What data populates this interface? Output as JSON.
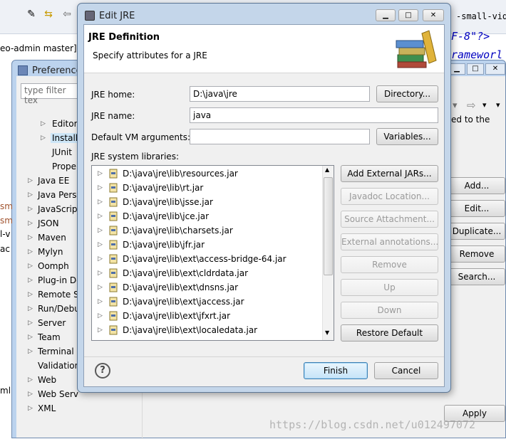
{
  "background": {
    "tab_fragment": "eo-admin master]",
    "code_lines": [
      "-small-video-",
      "F-8\"?>",
      "rameworl"
    ],
    "editor_text": "ed to the",
    "watermark": "https://blog.csdn.net/u012497072"
  },
  "preferences": {
    "title": "Preferences",
    "filter_placeholder": "type filter tex",
    "tree": [
      "Editor",
      "Installe",
      "JUnit",
      "Prope",
      "Java EE",
      "Java Pers",
      "JavaScript",
      "JSON",
      "Maven",
      "Mylyn",
      "Oomph",
      "Plug-in De",
      "Remote S",
      "Run/Debu",
      "Server",
      "Team",
      "Terminal",
      "Validation",
      "Web",
      "Web Serv",
      "XML"
    ],
    "buttons": {
      "add": "Add...",
      "edit": "Edit...",
      "duplicate": "Duplicate...",
      "remove": "Remove",
      "search": "Search...",
      "apply": "Apply"
    },
    "left_fragments": [
      "sm",
      "sm",
      "l-v",
      "ac",
      "ml"
    ]
  },
  "dialog": {
    "title": "Edit JRE",
    "banner_title": "JRE Definition",
    "banner_subtitle": "Specify attributes for a JRE",
    "jre_home_label": "JRE home:",
    "jre_home_value": "D:\\java\\jre",
    "directory_button": "Directory...",
    "jre_name_label": "JRE name:",
    "jre_name_value": "java",
    "vm_args_label": "Default VM arguments:",
    "vm_args_value": "",
    "variables_button": "Variables...",
    "libraries_label": "JRE system libraries:",
    "libraries": [
      "D:\\java\\jre\\lib\\resources.jar",
      "D:\\java\\jre\\lib\\rt.jar",
      "D:\\java\\jre\\lib\\jsse.jar",
      "D:\\java\\jre\\lib\\jce.jar",
      "D:\\java\\jre\\lib\\charsets.jar",
      "D:\\java\\jre\\lib\\jfr.jar",
      "D:\\java\\jre\\lib\\ext\\access-bridge-64.jar",
      "D:\\java\\jre\\lib\\ext\\cldrdata.jar",
      "D:\\java\\jre\\lib\\ext\\dnsns.jar",
      "D:\\java\\jre\\lib\\ext\\jaccess.jar",
      "D:\\java\\jre\\lib\\ext\\jfxrt.jar",
      "D:\\java\\jre\\lib\\ext\\localedata.jar"
    ],
    "side_buttons": {
      "add_external": "Add External JARs...",
      "javadoc": "Javadoc Location...",
      "source": "Source Attachment...",
      "annotations": "External annotations...",
      "remove": "Remove",
      "up": "Up",
      "down": "Down",
      "restore": "Restore Default"
    },
    "finish_button": "Finish",
    "cancel_button": "Cancel",
    "help_icon_text": "?"
  },
  "colors": {
    "accent": "#3c7fb1",
    "title_bar": "#c4d6ea",
    "disabled_text": "#9a9a9a"
  }
}
